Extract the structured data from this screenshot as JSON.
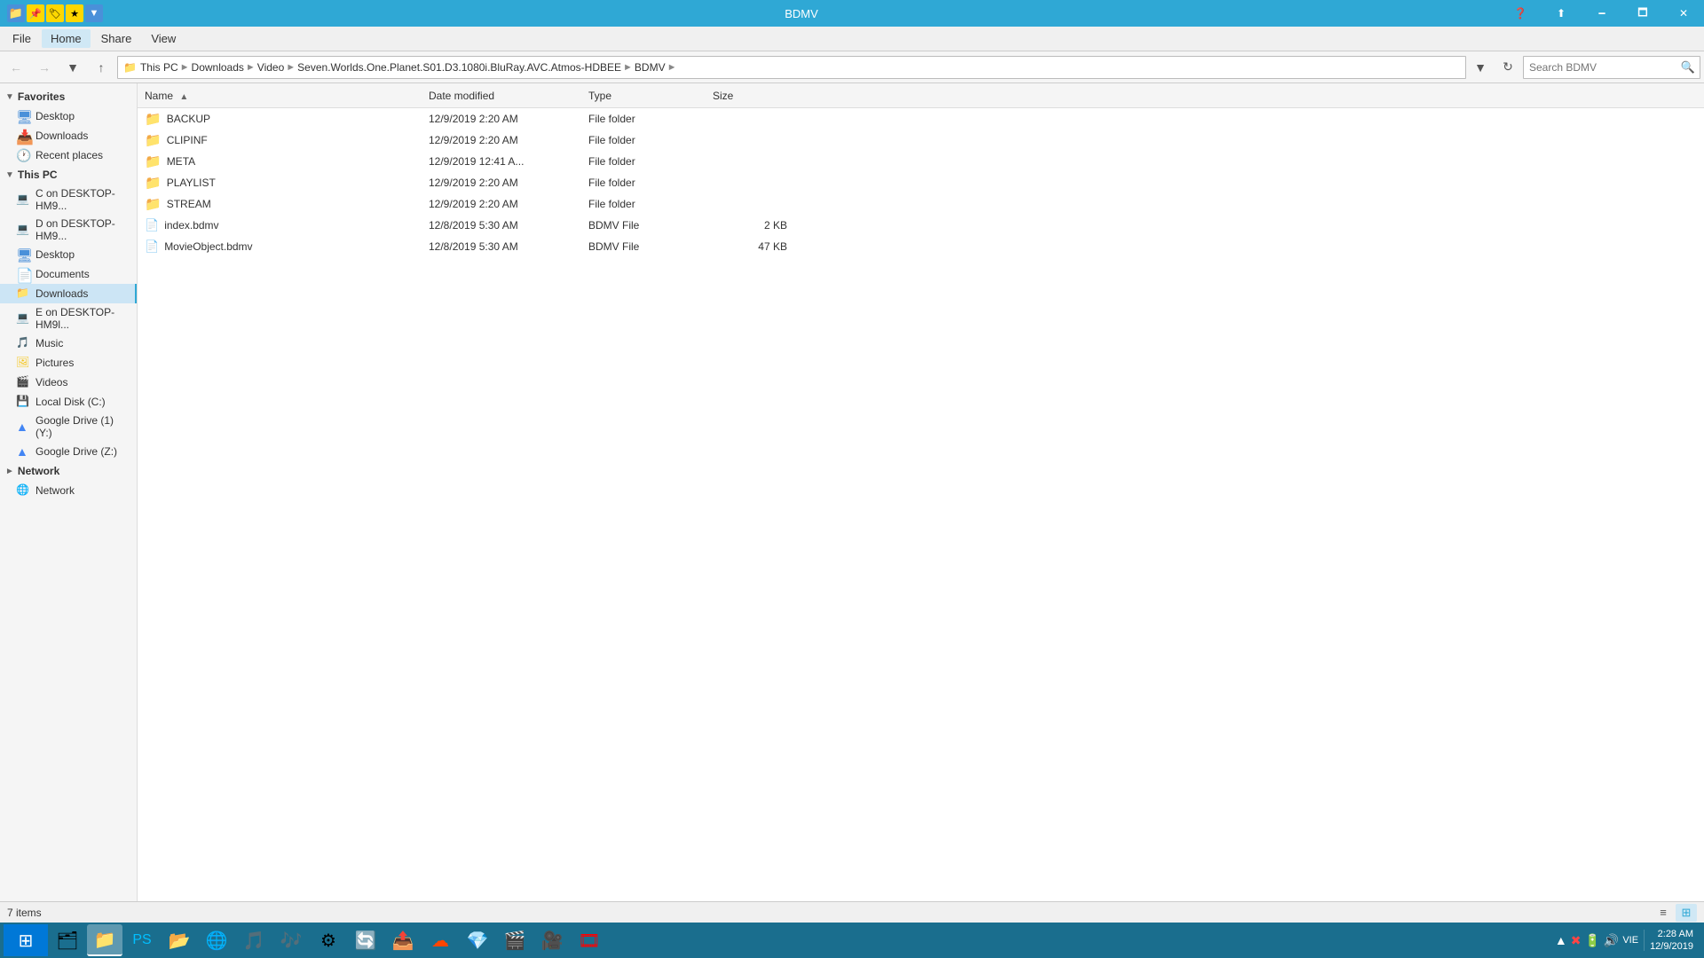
{
  "titleBar": {
    "title": "BDMV",
    "minimize": "🗕",
    "maximize": "🗖",
    "close": "✕"
  },
  "menuBar": {
    "items": [
      "File",
      "Home",
      "Share",
      "View"
    ]
  },
  "addressBar": {
    "breadcrumb": [
      "This PC",
      "Downloads",
      "Video",
      "Seven.Worlds.One.Planet.S01.D3.1080i.BluRay.AVC.Atmos-HDBEE",
      "BDMV"
    ],
    "searchPlaceholder": "Search BDMV",
    "searchValue": ""
  },
  "sidebar": {
    "favorites": {
      "header": "Favorites",
      "items": [
        {
          "name": "Desktop",
          "icon": "desktop"
        },
        {
          "name": "Downloads",
          "icon": "folder"
        },
        {
          "name": "Recent places",
          "icon": "recent"
        }
      ]
    },
    "thisPC": {
      "header": "This PC",
      "items": [
        {
          "name": "C on DESKTOP-HM9...",
          "icon": "drive"
        },
        {
          "name": "D on DESKTOP-HM9...",
          "icon": "drive"
        },
        {
          "name": "Desktop",
          "icon": "desktop"
        },
        {
          "name": "Documents",
          "icon": "folder"
        },
        {
          "name": "Downloads",
          "icon": "folder",
          "active": true
        },
        {
          "name": "E on DESKTOP-HM9l...",
          "icon": "drive"
        },
        {
          "name": "Music",
          "icon": "folder"
        },
        {
          "name": "Pictures",
          "icon": "folder"
        },
        {
          "name": "Videos",
          "icon": "folder"
        },
        {
          "name": "Local Disk (C:)",
          "icon": "drive"
        },
        {
          "name": "Google Drive (1) (Y:)",
          "icon": "gdrive"
        },
        {
          "name": "Google Drive (Z:)",
          "icon": "gdrive"
        }
      ]
    },
    "network": {
      "header": "Network",
      "items": []
    }
  },
  "fileList": {
    "columns": [
      "Name",
      "Date modified",
      "Type",
      "Size"
    ],
    "sortColumn": "Name",
    "sortDir": "asc",
    "files": [
      {
        "name": "BACKUP",
        "date": "12/9/2019 2:20 AM",
        "type": "File folder",
        "size": "",
        "isFolder": true
      },
      {
        "name": "CLIPINF",
        "date": "12/9/2019 2:20 AM",
        "type": "File folder",
        "size": "",
        "isFolder": true
      },
      {
        "name": "META",
        "date": "12/9/2019 12:41 A...",
        "type": "File folder",
        "size": "",
        "isFolder": true
      },
      {
        "name": "PLAYLIST",
        "date": "12/9/2019 2:20 AM",
        "type": "File folder",
        "size": "",
        "isFolder": true
      },
      {
        "name": "STREAM",
        "date": "12/9/2019 2:20 AM",
        "type": "File folder",
        "size": "",
        "isFolder": true
      },
      {
        "name": "index.bdmv",
        "date": "12/8/2019 5:30 AM",
        "type": "BDMV File",
        "size": "2 KB",
        "isFolder": false
      },
      {
        "name": "MovieObject.bdmv",
        "date": "12/8/2019 5:30 AM",
        "type": "BDMV File",
        "size": "47 KB",
        "isFolder": false
      }
    ]
  },
  "statusBar": {
    "itemCount": "7 items"
  },
  "taskbar": {
    "apps": [
      {
        "icon": "⊞",
        "name": "start"
      },
      {
        "icon": "🗂",
        "name": "file-explorer"
      },
      {
        "icon": "🔷",
        "name": "powershell"
      },
      {
        "icon": "📁",
        "name": "folder-app"
      },
      {
        "icon": "🌐",
        "name": "chrome"
      },
      {
        "icon": "🎵",
        "name": "media-player"
      },
      {
        "icon": "🍎",
        "name": "itunes"
      },
      {
        "icon": "⚙",
        "name": "settings"
      },
      {
        "icon": "🔄",
        "name": "refresh-app"
      },
      {
        "icon": "📤",
        "name": "filezilla"
      },
      {
        "icon": "☁",
        "name": "cloud-app"
      },
      {
        "icon": "💎",
        "name": "gem-app"
      },
      {
        "icon": "🎬",
        "name": "media-app"
      },
      {
        "icon": "🎞",
        "name": "video-app"
      },
      {
        "icon": "🎥",
        "name": "clapper"
      }
    ],
    "clock": {
      "time": "2:28 AM",
      "date": "12/9/2019"
    },
    "trayIcons": [
      "▲",
      "✖",
      "🔋",
      "🔊",
      "VIE"
    ]
  }
}
